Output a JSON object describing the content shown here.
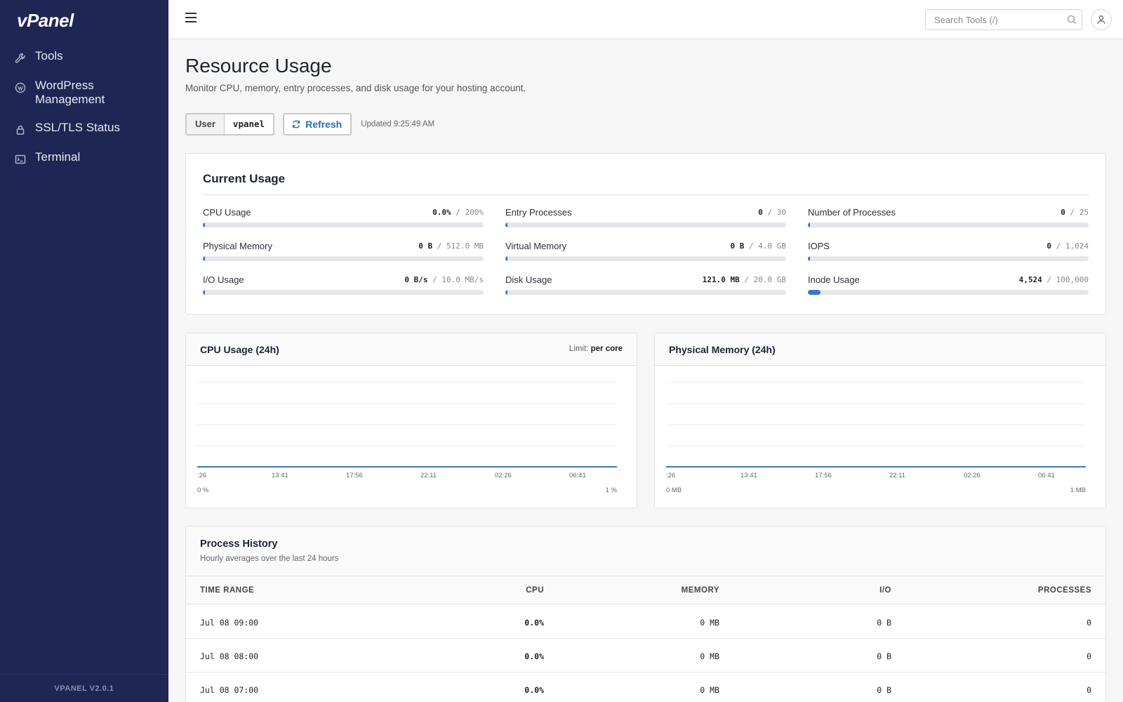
{
  "app": {
    "logo": "vPanel",
    "version": "VPANEL V2.0.1"
  },
  "sidebar": {
    "items": [
      {
        "label": "Tools",
        "icon": "wrench-icon"
      },
      {
        "label": "WordPress Management",
        "icon": "wordpress-icon"
      },
      {
        "label": "SSL/TLS Status",
        "icon": "lock-icon"
      },
      {
        "label": "Terminal",
        "icon": "terminal-icon"
      }
    ]
  },
  "topbar": {
    "search_placeholder": "Search Tools (/)"
  },
  "page": {
    "title": "Resource Usage",
    "subtitle": "Monitor CPU, memory, entry processes, and disk usage for your hosting account."
  },
  "controls": {
    "user_label": "User",
    "user_value": "vpanel",
    "refresh_label": "Refresh",
    "updated_text": "Updated 9:25:49 AM"
  },
  "current_usage": {
    "title": "Current Usage",
    "metrics": [
      {
        "label": "CPU Usage",
        "used": "0.0%",
        "limit": "/ 200%",
        "fraction": 0
      },
      {
        "label": "Entry Processes",
        "used": "0",
        "limit": "/ 30",
        "fraction": 0
      },
      {
        "label": "Number of Processes",
        "used": "0",
        "limit": "/ 25",
        "fraction": 0
      },
      {
        "label": "Physical Memory",
        "used": "0 B",
        "limit": "/ 512.0 MB",
        "fraction": 0
      },
      {
        "label": "Virtual Memory",
        "used": "0 B",
        "limit": "/ 4.0 GB",
        "fraction": 0
      },
      {
        "label": "IOPS",
        "used": "0",
        "limit": "/ 1,024",
        "fraction": 0
      },
      {
        "label": "I/O Usage",
        "used": "0 B/s",
        "limit": "/ 10.0 MB/s",
        "fraction": 0
      },
      {
        "label": "Disk Usage",
        "used": "121.0 MB",
        "limit": "/ 20.0 GB",
        "fraction": 0.006
      },
      {
        "label": "Inode Usage",
        "used": "4,524",
        "limit": "/ 100,000",
        "fraction": 0.045
      }
    ]
  },
  "charts": {
    "cpu": {
      "title": "CPU Usage (24h)",
      "limit_label": "Limit:",
      "limit_value": "per core"
    },
    "memory": {
      "title": "Physical Memory (24h)"
    }
  },
  "chart_data": [
    {
      "type": "line",
      "title": "CPU Usage (24h)",
      "x_ticks": [
        ":26",
        "13:41",
        "17:56",
        "22:11",
        "02:26",
        "06:41"
      ],
      "series": [
        {
          "values": [
            0,
            0,
            0,
            0,
            0,
            0
          ]
        }
      ],
      "y_range_labels": {
        "min": "0 %",
        "max": "1 %"
      },
      "color": "#3a78c2",
      "grid": true
    },
    {
      "type": "line",
      "title": "Physical Memory (24h)",
      "x_ticks": [
        ":26",
        "13:41",
        "17:56",
        "22:11",
        "02:26",
        "06:41"
      ],
      "series": [
        {
          "values": [
            0,
            0,
            0,
            0,
            0,
            0
          ]
        }
      ],
      "y_range_labels": {
        "min": "0 MB",
        "max": "1 MB"
      },
      "color": "#3a78c2",
      "grid": true
    }
  ],
  "process_history": {
    "title": "Process History",
    "subtitle": "Hourly averages over the last 24 hours",
    "columns": [
      "TIME RANGE",
      "CPU",
      "MEMORY",
      "I/O",
      "PROCESSES"
    ],
    "rows": [
      {
        "time": "Jul 08 09:00",
        "cpu": "0.0%",
        "memory": "0 MB",
        "io": "0 B",
        "processes": "0"
      },
      {
        "time": "Jul 08 08:00",
        "cpu": "0.0%",
        "memory": "0 MB",
        "io": "0 B",
        "processes": "0"
      },
      {
        "time": "Jul 08 07:00",
        "cpu": "0.0%",
        "memory": "0 MB",
        "io": "0 B",
        "processes": "0"
      }
    ]
  }
}
